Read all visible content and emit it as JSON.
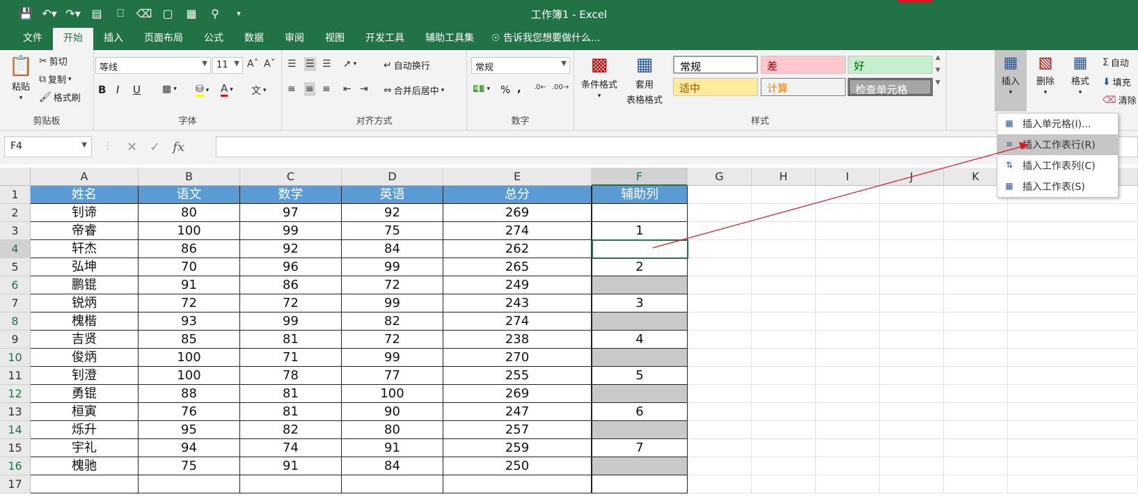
{
  "window": {
    "title": "工作簿1 - Excel"
  },
  "qat": {
    "icons": [
      "save-icon",
      "undo-icon",
      "redo-icon",
      "form-icon",
      "print-preview-icon",
      "clear-icon",
      "comment-icon",
      "table-icon",
      "find-icon",
      "more-icon"
    ]
  },
  "tabs": [
    "文件",
    "开始",
    "插入",
    "页面布局",
    "公式",
    "数据",
    "审阅",
    "视图",
    "开发工具",
    "辅助工具集"
  ],
  "tell_me": "告诉我您想要做什么...",
  "ribbon": {
    "clipboard": {
      "paste": "粘贴",
      "cut": "剪切",
      "copy": "复制",
      "format_painter": "格式刷",
      "label": "剪贴板"
    },
    "font": {
      "name": "等线",
      "size": "11",
      "label": "字体",
      "bold": "B",
      "italic": "I",
      "underline": "U",
      "font_color_letter": "A",
      "phonetic": "文"
    },
    "alignment": {
      "wrap": "自动换行",
      "merge": "合并后居中",
      "label": "对齐方式"
    },
    "number": {
      "format": "常规",
      "percent": "%",
      "comma": ",",
      "label": "数字"
    },
    "styles": {
      "conditional": "条件格式",
      "table_format_1": "套用",
      "table_format_2": "表格格式",
      "cells": [
        "常规",
        "差",
        "好",
        "适中",
        "计算",
        "检查单元格"
      ],
      "label": "样式"
    },
    "cells": {
      "insert": "插入",
      "delete": "删除",
      "format": "格式"
    },
    "editing": {
      "autosum": "自动",
      "fill": "填充",
      "clear": "清除"
    }
  },
  "namebox": "F4",
  "columns": [
    "A",
    "B",
    "C",
    "D",
    "E",
    "F",
    "G",
    "H",
    "I",
    "J",
    "K"
  ],
  "rows": [
    "1",
    "2",
    "3",
    "4",
    "5",
    "6",
    "7",
    "8",
    "9",
    "10",
    "11",
    "12",
    "13",
    "14",
    "15",
    "16",
    "17"
  ],
  "table": {
    "headers": [
      "姓名",
      "语文",
      "数学",
      "英语",
      "总分",
      "辅助列"
    ],
    "data": [
      [
        "钊谛",
        "80",
        "97",
        "92",
        "269",
        ""
      ],
      [
        "帝睿",
        "100",
        "99",
        "75",
        "274",
        "1"
      ],
      [
        "轩杰",
        "86",
        "92",
        "84",
        "262",
        ""
      ],
      [
        "弘坤",
        "70",
        "96",
        "99",
        "265",
        "2"
      ],
      [
        "鹏锟",
        "91",
        "86",
        "72",
        "249",
        ""
      ],
      [
        "锐炳",
        "72",
        "72",
        "99",
        "243",
        "3"
      ],
      [
        "槐楷",
        "93",
        "99",
        "82",
        "274",
        ""
      ],
      [
        "吉贤",
        "85",
        "81",
        "72",
        "238",
        "4"
      ],
      [
        "俊炳",
        "100",
        "71",
        "99",
        "270",
        ""
      ],
      [
        "钊澄",
        "100",
        "78",
        "77",
        "255",
        "5"
      ],
      [
        "勇锟",
        "88",
        "81",
        "100",
        "269",
        ""
      ],
      [
        "桓寅",
        "76",
        "81",
        "90",
        "247",
        "6"
      ],
      [
        "烁升",
        "95",
        "82",
        "80",
        "257",
        ""
      ],
      [
        "宇礼",
        "94",
        "74",
        "91",
        "259",
        "7"
      ],
      [
        "槐驰",
        "75",
        "91",
        "84",
        "250",
        ""
      ]
    ],
    "gray_rows": [
      6,
      8,
      10,
      12,
      14,
      16
    ],
    "header_color": "#5b9bd5"
  },
  "insert_menu": {
    "items": [
      "插入单元格(I)...",
      "插入工作表行(R)",
      "插入工作表列(C)",
      "插入工作表(S)"
    ],
    "highlighted": 1
  },
  "colors": {
    "excel_green": "#217346",
    "annotation_red": "#e81123"
  }
}
